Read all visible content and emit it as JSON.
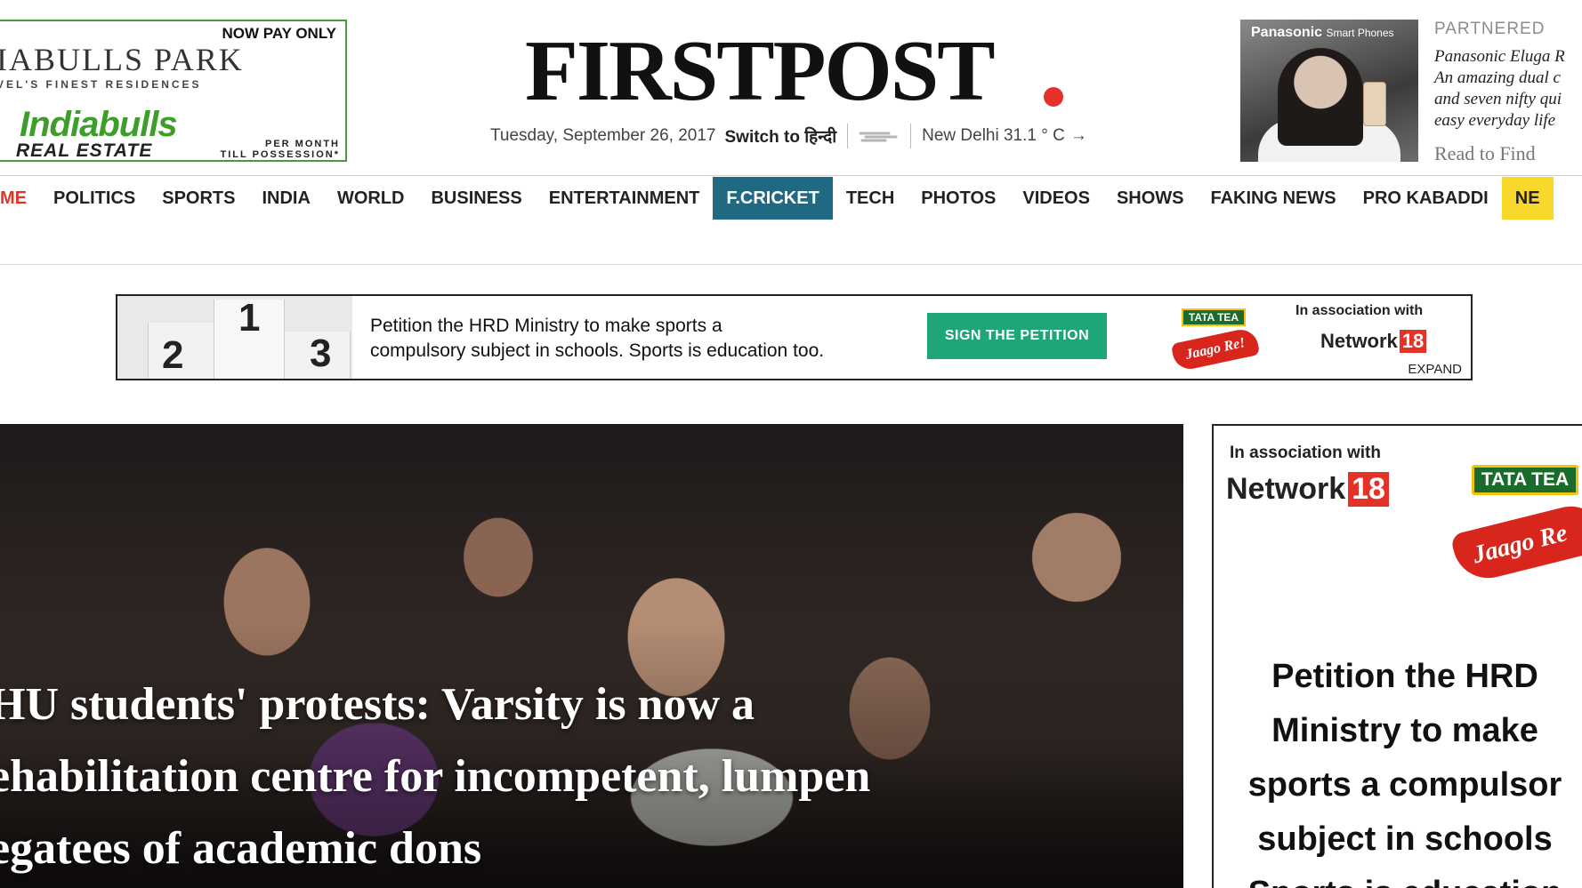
{
  "header": {
    "left_ad": {
      "tagline": "NOW PAY ONLY",
      "park_name": "IABULLS PARK",
      "residences": "VEL'S FINEST RESIDENCES",
      "brand": "Indiabulls",
      "division": "REAL ESTATE",
      "per_month": "PER MONTH",
      "possession": "TILL POSSESSION*"
    },
    "logo": "FIRSTPOST",
    "date": "Tuesday, September 26, 2017",
    "switch_label": "Switch to हिन्दी",
    "weather": "New Delhi 31.1 ° C",
    "weather_arrow": "→",
    "right_ad": {
      "brand": "Panasonic",
      "brand_sub": "Smart Phones"
    },
    "partnered": {
      "label": "PARTNERED",
      "lines": [
        "Panasonic Eluga R",
        "An amazing dual c",
        "and seven nifty qui",
        "easy everyday life"
      ],
      "cta": "Read to Find"
    }
  },
  "nav": {
    "items": [
      {
        "label": "ME"
      },
      {
        "label": "POLITICS"
      },
      {
        "label": "SPORTS"
      },
      {
        "label": "INDIA"
      },
      {
        "label": "WORLD"
      },
      {
        "label": "BUSINESS"
      },
      {
        "label": "ENTERTAINMENT"
      },
      {
        "label": "F.CRICKET"
      },
      {
        "label": "TECH"
      },
      {
        "label": "PHOTOS"
      },
      {
        "label": "VIDEOS"
      },
      {
        "label": "SHOWS"
      },
      {
        "label": "FAKING NEWS"
      },
      {
        "label": "PRO KABADDI"
      },
      {
        "label": "NE"
      }
    ]
  },
  "banner": {
    "podium": [
      "2",
      "1",
      "3"
    ],
    "text_line1": "Petition the HRD Ministry to make  sports a",
    "text_line2": "compulsory subject in schools. Sports is education too.",
    "button": "SIGN THE PETITION",
    "tata_label": "TATA TEA",
    "jaago_label": "Jaago Re!",
    "assoc": "In association with",
    "network": "Network",
    "network_num": "18",
    "expand": "EXPAND"
  },
  "hero": {
    "title_line1": "HU students' protests: Varsity is now a",
    "title_line2": "ehabilitation centre for incompetent, lumpen",
    "title_line3": "egatees of academic dons"
  },
  "side_ad": {
    "assoc": "In association with",
    "network": "Network",
    "network_num": "18",
    "tata_label": "TATA TEA",
    "jaago_label": "Jaago Re",
    "copy_lines": [
      "Petition the HRD",
      "Ministry to make",
      "sports a compulsor",
      "subject in schools",
      "Sports is education"
    ]
  },
  "colors": {
    "accent_red": "#e53228",
    "nav_active": "#1f6a82",
    "nav_highlight": "#f8d82a",
    "petition_button": "#1ea676",
    "indiabulls_green": "#3f9e2b"
  }
}
